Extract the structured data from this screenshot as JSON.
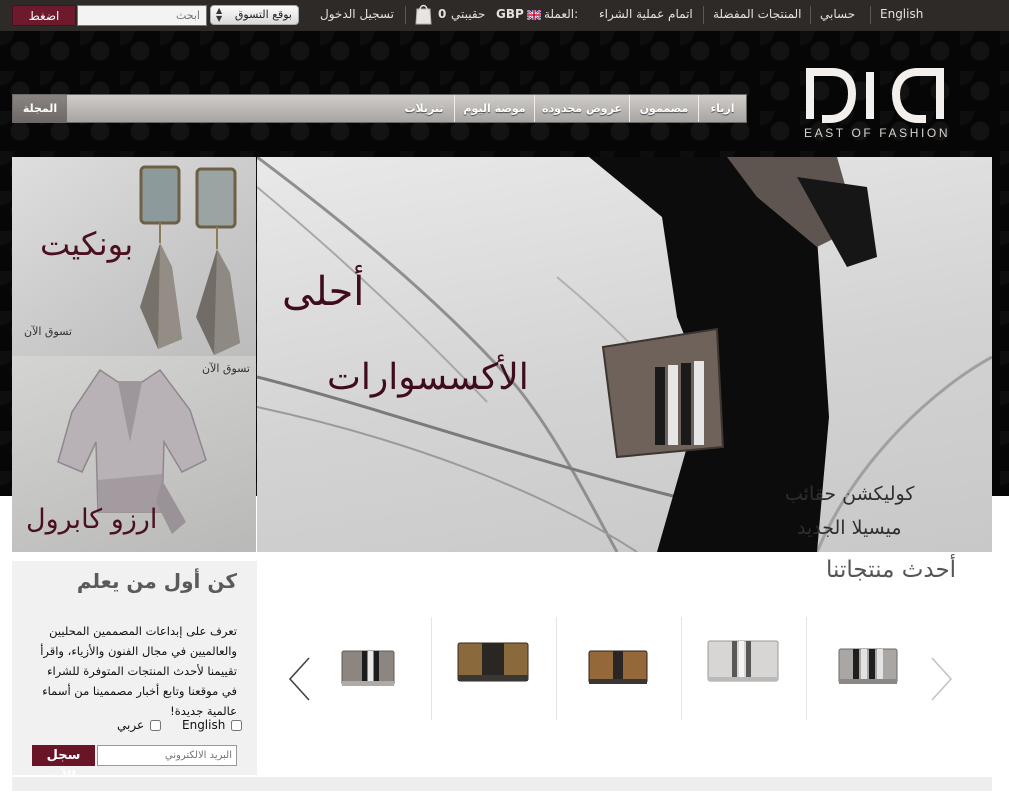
{
  "topbar": {
    "language_link": "English",
    "account_link": "حسابي",
    "favorites_link": "المنتجات المفضلة",
    "checkout_link": "اتمام عملية الشراء",
    "currency_label": "العملة:",
    "currency_value": "GBP",
    "bag_label": "حقيبتي",
    "bag_count": "0",
    "login_link": "تسجيل الدخول",
    "shop_location_select": "بوقع التسوق",
    "search_placeholder": "ابحث",
    "search_button": "اضغط"
  },
  "brand": {
    "tagline": "EAST OF FASHION"
  },
  "nav": {
    "items": [
      "ازياء",
      "مصممون",
      "عروض محدودة",
      "موضة اليوم",
      "تنزيلات"
    ],
    "magazine": "المجلة"
  },
  "promos": {
    "tile1": {
      "title": "بونكيت",
      "cta": "تسوق الآن"
    },
    "tile2": {
      "title": "ارزو كابرول",
      "cta": "تسوق الآن"
    }
  },
  "hero": {
    "headline_line1": "أحلى",
    "headline_line2": "الأكسسوارات",
    "caption_line1": "كوليكشن حقائب",
    "caption_line2": "ميسيلا الجديد"
  },
  "newsletter": {
    "title": "كن أول من يعلم",
    "body": "تعرف على إبداعات المصممين المحليين والعالميين في مجال الفنون والأزياء، واقرأ تقييمنا لأحدث المنتجات المتوفرة للشراء في موقعنا وتابع أخبار مصممينا من أسماء عالمية جديدة!",
    "option_english": "English",
    "option_arabic": "عربي",
    "email_placeholder": "البريد الالكتروني",
    "submit_button": "سجل الآن"
  },
  "latest": {
    "title": "أحدث منتجاتنا",
    "icons": [
      "chevron-left-icon",
      "chevron-right-icon"
    ]
  },
  "colors": {
    "accent": "#6d1a2c",
    "topbar": "#2e2a28",
    "header_bg": "#070606",
    "hero_text": "#3e0c1b"
  }
}
